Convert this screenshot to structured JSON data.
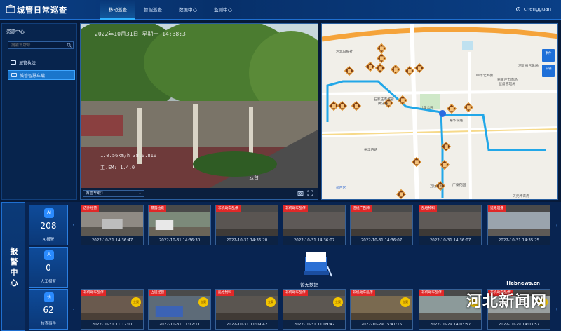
{
  "app": {
    "title": "城管日常巡查",
    "user": "chengguan"
  },
  "nav": [
    {
      "label": "移动巡查",
      "active": true
    },
    {
      "label": "智能巡查",
      "active": false
    },
    {
      "label": "数据中心",
      "active": false
    },
    {
      "label": "监测中心",
      "active": false
    }
  ],
  "sidebar": {
    "title": "资源中心",
    "search_placeholder": "搜索车牌号",
    "items": [
      {
        "label": "城管执法",
        "selected": false
      },
      {
        "label": "城管智慧车载",
        "selected": true
      }
    ]
  },
  "video": {
    "timestamp": "2022年10月31日 星期一 14:38:3",
    "osd_line1": "1.0.56km/h  38.0.810",
    "osd_line2": "主.EM: 1.4.0",
    "watermark": "云台",
    "camera_select": "城管车载1"
  },
  "map": {
    "buttons": [
      "事件",
      "车辆"
    ],
    "labels": [
      {
        "text": "河北日报社",
        "blue": false
      },
      {
        "text": "裕华西路",
        "blue": false
      },
      {
        "text": "石家庄市城管",
        "blue": false
      },
      {
        "text": "执法局",
        "blue": false
      },
      {
        "text": "裕华东路",
        "blue": false
      },
      {
        "text": "儿童公园",
        "blue": false
      },
      {
        "text": "中华北大街",
        "blue": false
      },
      {
        "text": "万达广场",
        "blue": false
      },
      {
        "text": "广泰花园",
        "blue": false
      },
      {
        "text": "天元神奇府",
        "blue": false
      },
      {
        "text": "石家庄市市场",
        "blue": false
      },
      {
        "text": "监督管理局",
        "blue": false
      },
      {
        "text": "桥西区",
        "blue": true
      },
      {
        "text": "河北省气象局",
        "blue": false
      }
    ]
  },
  "alarm": {
    "panel_title": "报警中心",
    "stats": [
      {
        "icon": "AI",
        "value": "208",
        "label": "AI报警"
      },
      {
        "icon": "人",
        "value": "0",
        "label": "人工报警"
      },
      {
        "icon": "核",
        "value": "62",
        "label": "核查事件"
      }
    ],
    "ai_alerts": [
      {
        "tag": "店外经营",
        "time": "2022-10-31 14:36:47"
      },
      {
        "tag": "暴露垃圾",
        "time": "2022-10-31 14:36:30"
      },
      {
        "tag": "非机动车乱停",
        "time": "2022-10-31 14:36:20"
      },
      {
        "tag": "非机动车乱停",
        "time": "2022-10-31 14:36:07"
      },
      {
        "tag": "违规广告牌",
        "time": "2022-10-31 14:36:07"
      },
      {
        "tag": "乱堆物料",
        "time": "2022-10-31 14:36:07"
      },
      {
        "tag": "道路遗撒",
        "time": "2022-10-31 14:35:25"
      }
    ],
    "no_data": "暂无数据",
    "events": [
      {
        "tag": "非机动车乱停",
        "time": "2022-10-31 11:12:11",
        "stamp": "立案"
      },
      {
        "tag": "占道经营",
        "time": "2022-10-31 11:12:11",
        "stamp": "立案"
      },
      {
        "tag": "乱堆物料",
        "time": "2022-10-31 11:09:42",
        "stamp": "立案"
      },
      {
        "tag": "非机动车乱停",
        "time": "2022-10-31 11:09:42",
        "stamp": "立案"
      },
      {
        "tag": "非机动车乱停",
        "time": "2022-10-29 15:41:15",
        "stamp": "立案"
      },
      {
        "tag": "非机动车乱停",
        "time": "2022-10-29 14:03:57",
        "stamp": "立案"
      },
      {
        "tag": "非机动车乱停",
        "time": "2022-10-29 14:03:57",
        "stamp": "立案"
      }
    ]
  },
  "watermark": {
    "url": "Hebnews.cn",
    "text": "河北新闻网"
  }
}
